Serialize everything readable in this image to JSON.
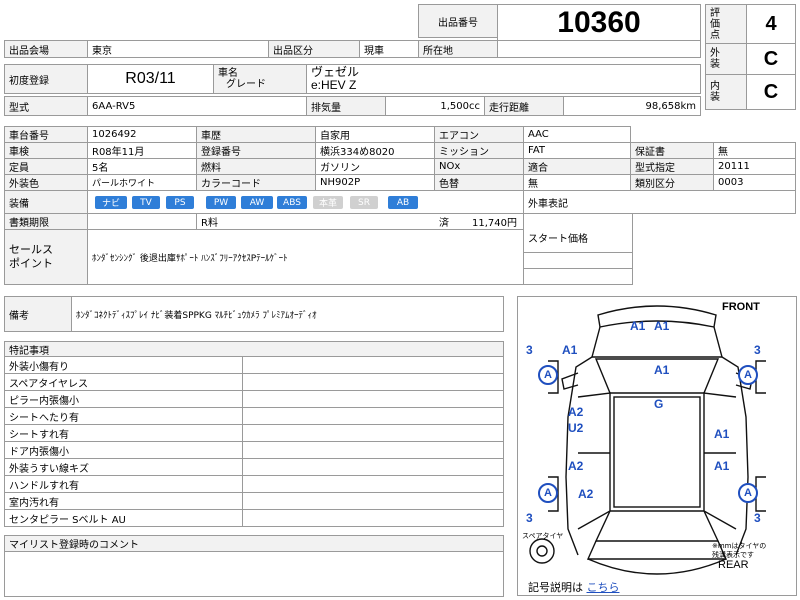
{
  "header": {
    "lot_label": "出品番号",
    "lot_number": "10360",
    "score_label": [
      "評",
      "価",
      "点"
    ],
    "score_value": "4",
    "exterior_label": [
      "外",
      "装"
    ],
    "exterior_value": "C",
    "interior_label": [
      "内",
      "装"
    ],
    "interior_value": "C"
  },
  "venue": {
    "venue_label": "出品会場",
    "venue_value": "東京",
    "type_label": "出品区分",
    "type_value": "現車",
    "location_label": "所在地",
    "location_value": ""
  },
  "reg": {
    "first_reg_label": "初度登録",
    "first_reg_value": "R03/11",
    "name_label_1": "車名",
    "name_label_2": "グレード",
    "name_value_1": "ヴェゼル",
    "name_value_2": "e:HEV Z"
  },
  "model": {
    "model_label": "型式",
    "model_value": "6AA-RV5",
    "disp_label": "排気量",
    "disp_value": "1,500cc",
    "mileage_label": "走行距離",
    "mileage_value": "98,658km"
  },
  "details": {
    "chassis_label": "車台番号",
    "chassis_value": "1026492",
    "history_label": "車歴",
    "history_value": "自家用",
    "ac_label": "エアコン",
    "ac_value": "AAC",
    "inspect_label": "車検",
    "inspect_value": "R08年11月",
    "plate_label": "登録番号",
    "plate_value": "横浜334め8020",
    "mission_label": "ミッション",
    "mission_value": "FAT",
    "warranty_label": "保証書",
    "warranty_value": "無",
    "capacity_label": "定員",
    "capacity_value": "5名",
    "fuel_label": "燃料",
    "fuel_value": "ガソリン",
    "nox_label": "NOx",
    "nox_value": "",
    "compliance_label": "適合",
    "compliance_value": "",
    "designation_label": "型式指定",
    "designation_value": "20111",
    "color_label": "外装色",
    "color_value": "パールホワイト",
    "colorcode_label": "カラーコード",
    "colorcode_value": "NH902P",
    "recolor_label": "色替",
    "recolor_value": "無",
    "category_label": "類別区分",
    "category_value": "0003",
    "equipment_label": "装備",
    "equipment": [
      {
        "label": "ナビ",
        "on": true
      },
      {
        "label": "TV",
        "on": true
      },
      {
        "label": "PS",
        "on": true
      },
      {
        "label": "PW",
        "on": true
      },
      {
        "label": "AW",
        "on": true
      },
      {
        "label": "ABS",
        "on": true
      },
      {
        "label": "本革",
        "on": false
      },
      {
        "label": "SR",
        "on": false
      },
      {
        "label": "AB",
        "on": true
      }
    ],
    "recycle_label": "外車表記",
    "docs_label": "書類期限",
    "docs_r": "R料",
    "docs_paid": "済",
    "docs_amount": "11,740円",
    "start_price_label": "スタート価格",
    "sales_label_1": "セールス",
    "sales_label_2": "ポイント",
    "sales_text": "ﾎﾝﾀﾞｾﾝｼﾝｸﾞ 後退出庫ｻﾎﾟｰﾄ ﾊﾝｽﾞﾌﾘｰｱｸｾｽPﾃｰﾙｹﾞｰﾄ"
  },
  "notes": {
    "label": "備考",
    "text": "ﾎﾝﾀﾞｺﾈｸﾄﾃﾞｨｽﾌﾟﾚｲ ﾅﾋﾞ装着SPPKG ﾏﾙﾁﾋﾞｭｳｶﾒﾗ ﾌﾟﾚﾐｱﾑｵｰﾃﾞｨｵ"
  },
  "special": {
    "title": "特記事項",
    "items": [
      "外装小傷有り",
      "スペアタイヤレス",
      "ピラー内張傷小",
      "シートへたり有",
      "シートすれ有",
      "ドア内張傷小",
      "外装うすい線キズ",
      "ハンドルすれ有",
      "室内汚れ有",
      "センタピラー Sベルト AU"
    ]
  },
  "mylist": {
    "label": "マイリスト登録時のコメント"
  },
  "diagram": {
    "front": "FRONT",
    "rear": "REAR",
    "spare": "スペアタイヤ",
    "tire_note_1": "※mmはタイヤの",
    "tire_note_2": "残溝表示です",
    "legend_label": "記号説明は",
    "legend_link": "こちら",
    "marks": {
      "top_a1a": "A1",
      "top_a1b": "A1",
      "tl_3": "3",
      "tr_3": "3",
      "bl_3": "3",
      "br_3": "3",
      "left_a1": "A1",
      "hood_a1": "A1",
      "roof_g": "G",
      "door_a2": "A2",
      "door_u2": "U2",
      "rear_a2": "A2",
      "rear_a2b": "A2",
      "right_a1a": "A1",
      "right_a1b": "A1",
      "wheel_fl": "A",
      "wheel_fr": "A",
      "wheel_rl": "A",
      "wheel_rr": "A"
    }
  }
}
